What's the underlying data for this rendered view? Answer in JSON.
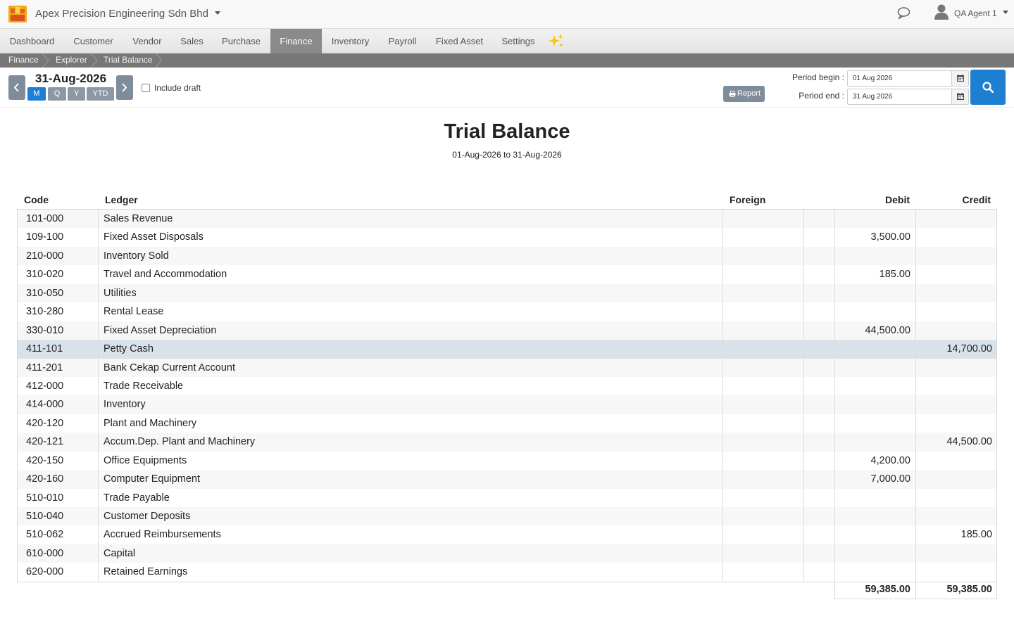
{
  "header": {
    "company": "Apex Precision Engineering Sdn Bhd",
    "user": "QA Agent 1"
  },
  "nav": {
    "items": [
      {
        "label": "Dashboard"
      },
      {
        "label": "Customer"
      },
      {
        "label": "Vendor"
      },
      {
        "label": "Sales"
      },
      {
        "label": "Purchase"
      },
      {
        "label": "Finance",
        "active": true
      },
      {
        "label": "Inventory"
      },
      {
        "label": "Payroll"
      },
      {
        "label": "Fixed Asset"
      },
      {
        "label": "Settings"
      }
    ]
  },
  "breadcrumb": [
    "Finance",
    "Explorer",
    "Trial Balance"
  ],
  "toolbar": {
    "date": "31-Aug-2026",
    "periods": [
      "M",
      "Q",
      "Y",
      "YTD"
    ],
    "active_period": "M",
    "include_draft_label": "Include draft",
    "include_draft_checked": false,
    "report_label": "Report",
    "period_begin_label": "Period begin :",
    "period_begin_value": "01 Aug 2026",
    "period_end_label": "Period end :",
    "period_end_value": "31 Aug 2026"
  },
  "report": {
    "title": "Trial Balance",
    "subtitle": "01-Aug-2026 to 31-Aug-2026",
    "columns": {
      "code": "Code",
      "ledger": "Ledger",
      "foreign": "Foreign",
      "debit": "Debit",
      "credit": "Credit"
    },
    "rows": [
      {
        "code": "101-000",
        "ledger": "Sales Revenue",
        "debit": "",
        "credit": ""
      },
      {
        "code": "109-100",
        "ledger": "Fixed Asset Disposals",
        "debit": "3,500.00",
        "credit": ""
      },
      {
        "code": "210-000",
        "ledger": "Inventory Sold",
        "debit": "",
        "credit": ""
      },
      {
        "code": "310-020",
        "ledger": "Travel and Accommodation",
        "debit": "185.00",
        "credit": ""
      },
      {
        "code": "310-050",
        "ledger": "Utilities",
        "debit": "",
        "credit": ""
      },
      {
        "code": "310-280",
        "ledger": "Rental Lease",
        "debit": "",
        "credit": ""
      },
      {
        "code": "330-010",
        "ledger": "Fixed Asset Depreciation",
        "debit": "44,500.00",
        "credit": ""
      },
      {
        "code": "411-101",
        "ledger": "Petty Cash",
        "debit": "",
        "credit": "14,700.00",
        "highlight": true
      },
      {
        "code": "411-201",
        "ledger": "Bank Cekap Current Account",
        "debit": "",
        "credit": ""
      },
      {
        "code": "412-000",
        "ledger": "Trade Receivable",
        "debit": "",
        "credit": ""
      },
      {
        "code": "414-000",
        "ledger": "Inventory",
        "debit": "",
        "credit": ""
      },
      {
        "code": "420-120",
        "ledger": "Plant and Machinery",
        "debit": "",
        "credit": ""
      },
      {
        "code": "420-121",
        "ledger": "Accum.Dep. Plant and Machinery",
        "debit": "",
        "credit": "44,500.00"
      },
      {
        "code": "420-150",
        "ledger": "Office Equipments",
        "debit": "4,200.00",
        "credit": ""
      },
      {
        "code": "420-160",
        "ledger": "Computer Equipment",
        "debit": "7,000.00",
        "credit": ""
      },
      {
        "code": "510-010",
        "ledger": "Trade Payable",
        "debit": "",
        "credit": ""
      },
      {
        "code": "510-040",
        "ledger": "Customer Deposits",
        "debit": "",
        "credit": ""
      },
      {
        "code": "510-062",
        "ledger": "Accrued Reimbursements",
        "debit": "",
        "credit": "185.00"
      },
      {
        "code": "610-000",
        "ledger": "Capital",
        "debit": "",
        "credit": ""
      },
      {
        "code": "620-000",
        "ledger": "Retained Earnings",
        "debit": "",
        "credit": ""
      }
    ],
    "totals": {
      "debit": "59,385.00",
      "credit": "59,385.00"
    }
  },
  "colors": {
    "accent": "#1d7fd1",
    "nav_active": "#8a8a8a",
    "breadcrumb_bg": "#777777",
    "row_highlight": "#d9e2ea"
  }
}
